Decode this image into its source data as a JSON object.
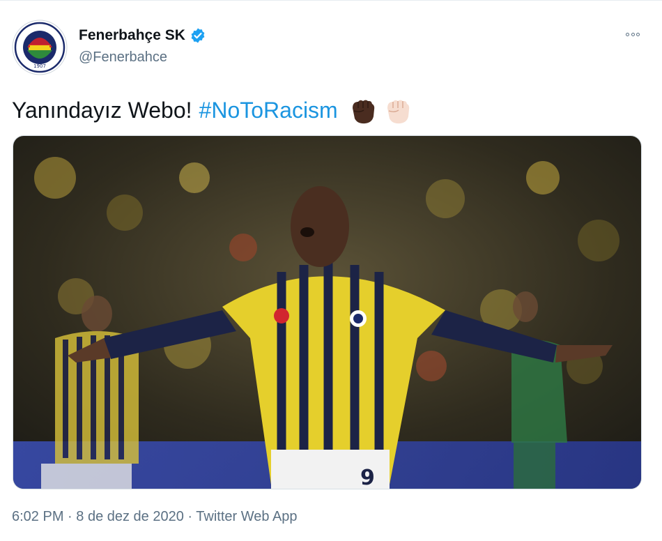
{
  "tweet": {
    "display_name": "Fenerbahçe SK",
    "handle": "@Fenerbahce",
    "verified_icon": "verified-badge-icon",
    "text_main": "Yanındayız Webo!",
    "hashtag": "#NoToRacism",
    "emojis": [
      "dark-raised-fist-icon",
      "light-raised-fist-icon"
    ],
    "time": "6:02 PM",
    "separator": "·",
    "date": "8 de dez de 2020",
    "source": "Twitter Web App",
    "avatar_logo_year": "1907",
    "jersey_number": "9",
    "accent_color": "#1b95e0"
  }
}
